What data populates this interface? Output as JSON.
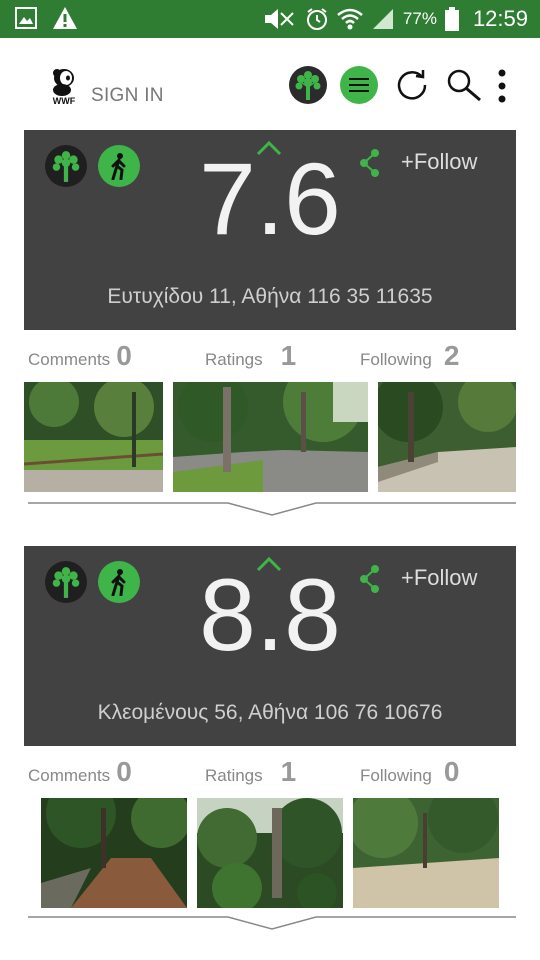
{
  "status_bar": {
    "battery_percent": "77%",
    "time": "12:59"
  },
  "app_bar": {
    "sign_in_label": "SIGN IN"
  },
  "cards": [
    {
      "score": "7.6",
      "follow_label": "+Follow",
      "address": "Ευτυχίδου 11, Αθήνα 116 35 11635",
      "stats": {
        "comments_label": "Comments",
        "comments_count": "0",
        "ratings_label": "Ratings",
        "ratings_count": "1",
        "following_label": "Following",
        "following_count": "2"
      }
    },
    {
      "score": "8.8",
      "follow_label": "+Follow",
      "address": "Κλεομένους 56, Αθήνα 106 76 10676",
      "stats": {
        "comments_label": "Comments",
        "comments_count": "0",
        "ratings_label": "Ratings",
        "ratings_count": "1",
        "following_label": "Following",
        "following_count": "0"
      }
    }
  ],
  "colors": {
    "status_bar": "#2e7d32",
    "accent_green": "#3fb549",
    "card_bg": "#424242"
  },
  "icons": [
    "gallery-icon",
    "warning-icon",
    "mute-icon",
    "alarm-icon",
    "wifi-icon",
    "signal-icon",
    "battery-icon",
    "wwf-panda-logo",
    "tree-icon",
    "menu-icon",
    "refresh-icon",
    "search-icon",
    "more-vert-icon",
    "walk-icon",
    "chevron-up-icon",
    "share-icon",
    "chevron-down-icon"
  ]
}
